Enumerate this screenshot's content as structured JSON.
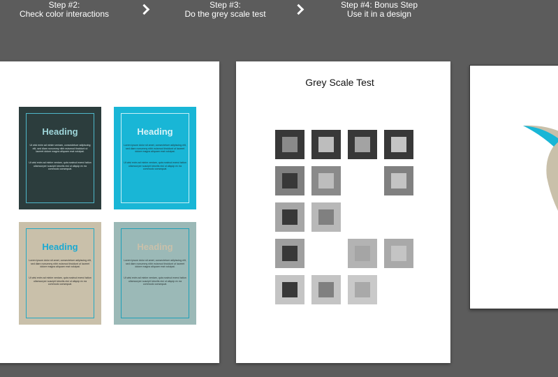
{
  "steps": [
    {
      "title": "Step #2:",
      "subtitle": "Check color interactions"
    },
    {
      "title": "Step #3:",
      "subtitle": "Do the grey scale test"
    },
    {
      "title": "Step #4: Bonus Step",
      "subtitle": "Use it in a design"
    }
  ],
  "color_cards": [
    {
      "heading": "Heading",
      "body1": "Ut wisi enim ad minim veniam, consectetuer adipiscing elit, sed diam nonummy nibh euismod tincidunt ut laoreet dolore magna aliquam erat volutpat.",
      "body2": "Ut wisi enim ad minim veniam, quis nostrud exerci tation ullamcorper suscipit lobortis nisl ut aliquip ex ea commodo consequat."
    },
    {
      "heading": "Heading",
      "body1": "Lorem ipsum dolor sit amet, consectetuer adipiscing elit, sed diam nonummy nibh euismod tincidunt ut laoreet dolore magna aliquam erat volutpat.",
      "body2": "Ut wisi enim ad minim veniam, quis nostrud exerci tation ullamcorper suscipit lobortis nisl ut aliquip ex ea commodo consequat."
    },
    {
      "heading": "Heading",
      "body1": "Lorem ipsum dolor sit amet, consectetuer adipiscing elit, sed diam nonummy nibh euismod tincidunt ut laoreet dolore magna aliquam erat volutpat.",
      "body2": "Ut wisi enim ad minim veniam, quis nostrud exerci tation ullamcorper suscipit lobortis nisl ut aliquip ex ea commodo consequat."
    },
    {
      "heading": "Heading",
      "body1": "Lorem ipsum dolor sit amet, consectetuer adipiscing elit, sed diam nonummy nibh euismod tincidunt ut laoreet dolore magna aliquam erat volutpat.",
      "body2": "Ut wisi enim ad minim veniam, quis nostrud exerci tation ullamcorper suscipit lobortis nisl ut aliquip ex ea commodo consequat."
    }
  ],
  "grey_scale": {
    "title": "Grey Scale Test",
    "rows": [
      [
        {
          "outer": "#383838",
          "inner": "#8a8a8a"
        },
        {
          "outer": "#383838",
          "inner": "#bdbdbd"
        },
        {
          "outer": "#383838",
          "inner": "#a3a3a3"
        },
        {
          "outer": "#383838",
          "inner": "#c4c4c4"
        }
      ],
      [
        {
          "outer": "#7f7f7f",
          "inner": "#383838"
        },
        {
          "outer": "#8a8a8a",
          "inner": "#bdbdbd"
        },
        null,
        {
          "outer": "#808080",
          "inner": "#c4c4c4"
        }
      ],
      [
        {
          "outer": "#a6a6a6",
          "inner": "#383838"
        },
        {
          "outer": "#b8b8b8",
          "inner": "#808080"
        },
        null,
        null
      ],
      [
        {
          "outer": "#9f9f9f",
          "inner": "#383838"
        },
        null,
        {
          "outer": "#b3b3b3",
          "inner": "#a5a5a5"
        },
        {
          "outer": "#a9a9a9",
          "inner": "#c4c4c4"
        }
      ],
      [
        {
          "outer": "#c4c4c4",
          "inner": "#383838"
        },
        {
          "outer": "#c4c4c4",
          "inner": "#808080"
        },
        {
          "outer": "#c9c9c9",
          "inner": "#a9a9a9"
        },
        null
      ]
    ]
  },
  "colors": {
    "background": "#5c5c5c",
    "accent_blue": "#19b6d6",
    "beige": "#c9c0aa"
  }
}
